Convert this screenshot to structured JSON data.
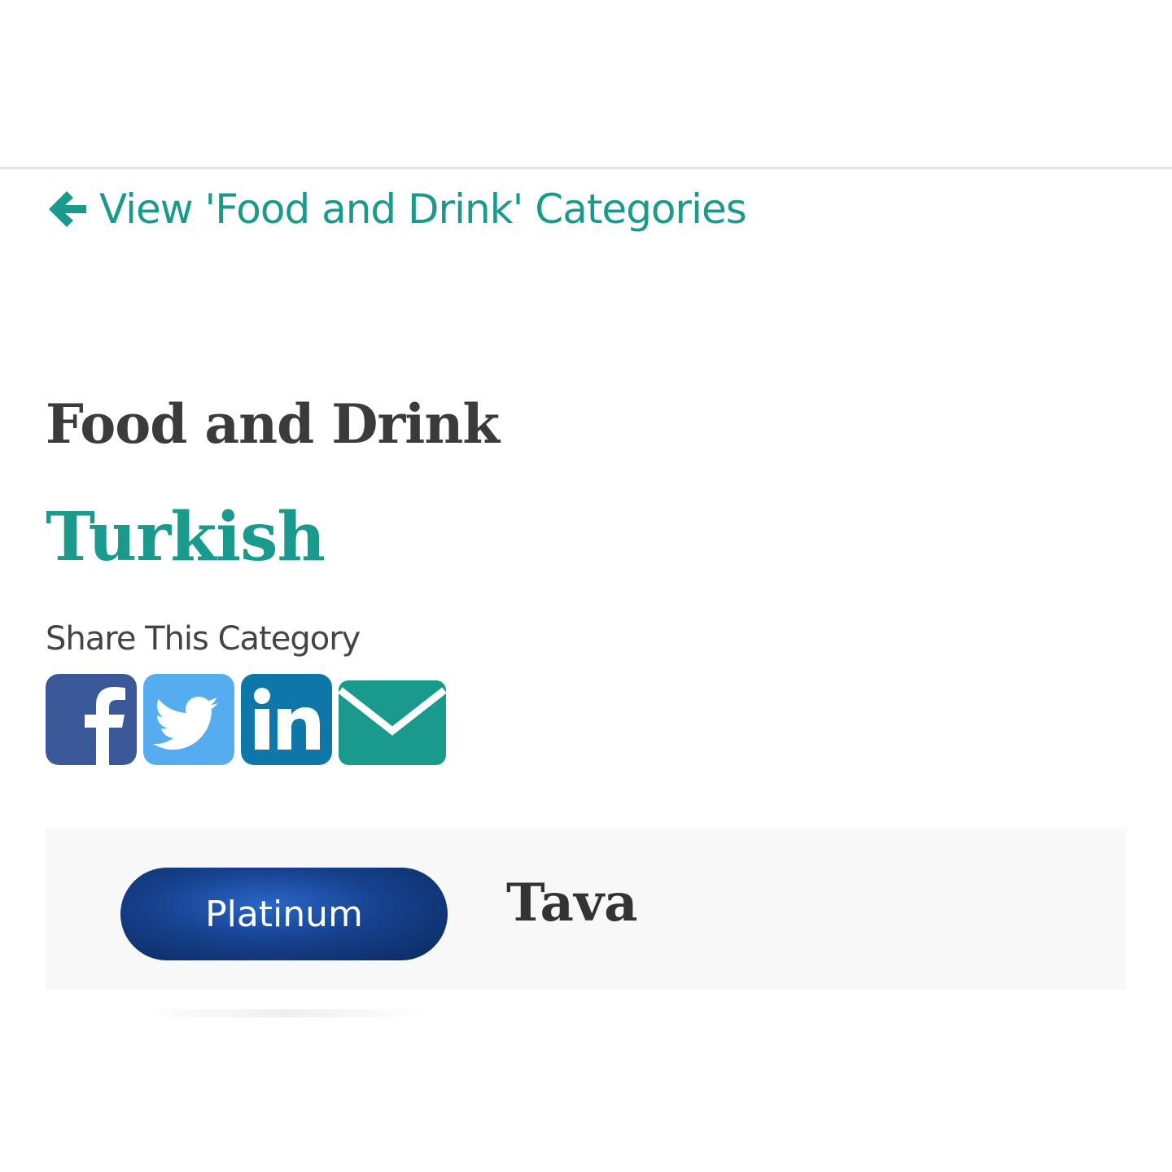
{
  "nav": {
    "back_link_label": "View 'Food and Drink' Categories"
  },
  "category": {
    "title": "Food and Drink",
    "subcategory": "Turkish"
  },
  "share": {
    "label": "Share This Category",
    "buttons": [
      {
        "network": "facebook",
        "icon": "facebook-icon",
        "color": "#3b5998"
      },
      {
        "network": "twitter",
        "icon": "twitter-icon",
        "color": "#55acee"
      },
      {
        "network": "linkedin",
        "icon": "linkedin-icon",
        "color": "#0e76a8"
      },
      {
        "network": "email",
        "icon": "envelope-icon",
        "color": "#1a9a8c"
      }
    ]
  },
  "listings": [
    {
      "badge": "Platinum",
      "name": "Tava"
    }
  ],
  "colors": {
    "accent": "#1a9a8c",
    "heading": "#3b3b3b",
    "badge_blue": "#16418d"
  }
}
